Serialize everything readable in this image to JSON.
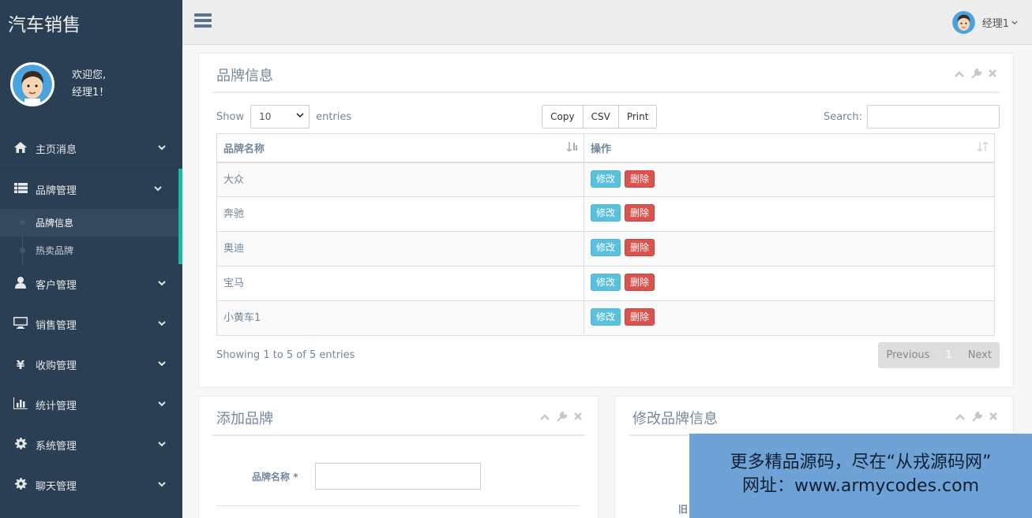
{
  "sidebar": {
    "brand": "汽车销售",
    "welcome_line1": "欢迎您,",
    "welcome_line2": "经理1！",
    "items": [
      {
        "label": "主页消息",
        "icon": "home-icon"
      },
      {
        "label": "品牌管理",
        "icon": "list-icon"
      },
      {
        "label": "客户管理",
        "icon": "user-icon"
      },
      {
        "label": "销售管理",
        "icon": "desktop-icon"
      },
      {
        "label": "收购管理",
        "icon": "yen-icon"
      },
      {
        "label": "统计管理",
        "icon": "bar-chart-icon"
      },
      {
        "label": "系统管理",
        "icon": "gear-icon"
      },
      {
        "label": "聊天管理",
        "icon": "gear-icon"
      }
    ],
    "submenu": [
      "品牌信息",
      "热卖品牌"
    ]
  },
  "topnav": {
    "username": "经理1"
  },
  "brand_panel": {
    "title": "品牌信息",
    "show_label": "Show",
    "page_length": "10",
    "entries_label": "entries",
    "buttons": [
      "Copy",
      "CSV",
      "Print"
    ],
    "search_label": "Search:",
    "columns": [
      "品牌名称",
      "操作"
    ],
    "rows": [
      {
        "name": "大众"
      },
      {
        "name": "奔驰"
      },
      {
        "name": "奥迪"
      },
      {
        "name": "宝马"
      },
      {
        "name": "小黄车1"
      }
    ],
    "edit_label": "修改",
    "delete_label": "删除",
    "info": "Showing 1 to 5 of 5 entries",
    "pager": {
      "previous": "Previous",
      "page": "1",
      "next": "Next"
    }
  },
  "add_panel": {
    "title": "添加品牌",
    "field_label": "品牌名称",
    "required_mark": "*"
  },
  "edit_panel": {
    "title": "修改品牌信息",
    "partial_label": "旧"
  },
  "watermark": {
    "line1": "更多精品源码，尽在“从戎源码网”",
    "line2": "网址：www.armycodes.com"
  }
}
